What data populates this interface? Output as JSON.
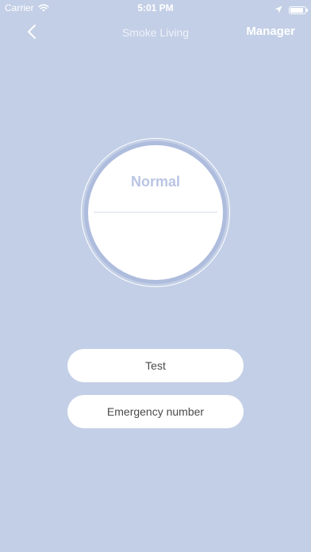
{
  "status_bar": {
    "carrier": "Carrier",
    "time": "5:01 PM",
    "icons": [
      "wifi-icon",
      "location-arrow-icon",
      "battery-icon"
    ]
  },
  "nav": {
    "back_icon": "chevron-left-icon",
    "title": "Smoke Living",
    "manager_label": "Manager"
  },
  "dial": {
    "status": "Normal"
  },
  "buttons": {
    "test_label": "Test",
    "emergency_label": "Emergency number"
  },
  "colors": {
    "background": "#c3cfe6",
    "dial_ring": "#aebcdd",
    "status_text": "#b9c5e2",
    "button_bg": "#ffffff",
    "button_text": "#4a4a4a"
  }
}
